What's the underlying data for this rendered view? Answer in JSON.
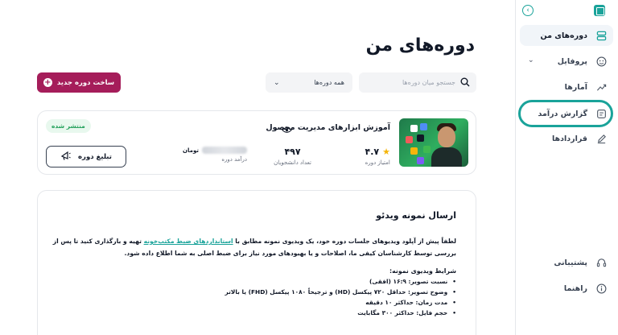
{
  "sidebar": {
    "items": [
      {
        "label": "دوره‌های من",
        "icon": "courses-icon"
      },
      {
        "label": "پروفایل",
        "icon": "profile-icon"
      },
      {
        "label": "آمارها",
        "icon": "stats-icon"
      },
      {
        "label": "گزارش درآمد",
        "icon": "income-report-icon"
      },
      {
        "label": "قراردادها",
        "icon": "contracts-icon"
      }
    ],
    "bottom": [
      {
        "label": "پشتیبانی",
        "icon": "support-icon"
      },
      {
        "label": "راهنما",
        "icon": "help-icon"
      }
    ]
  },
  "header": {
    "title": "دوره‌های من",
    "search_placeholder": "جستجو میان دوره‌ها",
    "filter_value": "همه دوره‌ها",
    "new_course_label": "ساخت دوره جدید"
  },
  "course": {
    "title": "آموزش ابزارهای مدیریت محصول",
    "status": "منتشر شده",
    "rating": "۴.۷",
    "rating_label": "امتیاز دوره",
    "students": "۴۹۷",
    "students_label": "تعداد دانشجویان",
    "income_currency": "تومان",
    "income_label": "درآمد دوره",
    "promo_label": "تبلیغ دوره"
  },
  "info": {
    "title": "ارسال نمونه ویدئو",
    "text_before_link": "لطفاً پیش از آپلود ویدیوهای جلسات دوره خود، یک ویدیوی نمونه مطابق با ",
    "link_text": "استانداردهای ضبط مکتب‌خونه",
    "text_after_link": " تهیه و بارگذاری کنید تا پس از بررسی توسط کارشناسان کیفی ما، اصلاحات و یا بهبودهای مورد نیاز برای ضبط اصلی به شما اطلاع داده شود.",
    "conditions_title": "شرایط ویدیوی نمونه:",
    "conditions": [
      "نسبت تصویر: ۱۶:۹ (افقی)",
      "وضوح تصویر: حداقل ۷۲۰ پیکسل (HD) و ترجیحاً ۱۰۸۰ پیکسل (FHD) یا بالاتر",
      "مدت زمان: حداکثر ۱۰ دقیقه",
      "حجم فایل: حداکثر ۳۰۰ مگابایت"
    ]
  },
  "colors": {
    "accent": "#1aa39a",
    "brand_button": "#a51d5a",
    "published": "#22a05a",
    "star": "#f5b50a"
  }
}
